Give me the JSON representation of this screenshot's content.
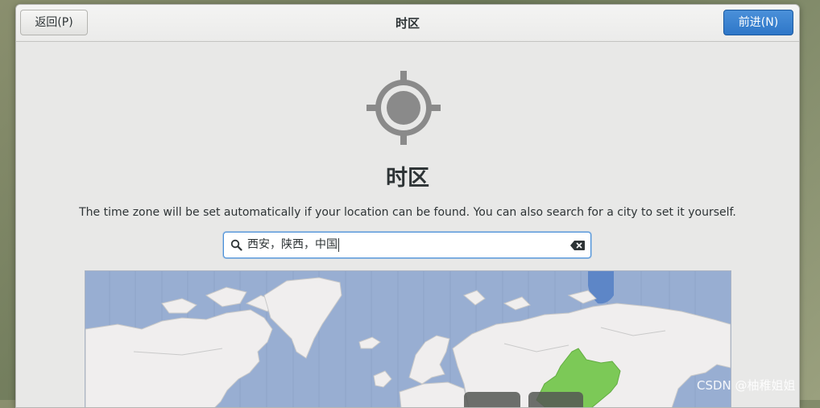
{
  "headerbar": {
    "back_label": "返回(P)",
    "title": "时区",
    "next_label": "前进(N)"
  },
  "page": {
    "title": "时区",
    "description": "The time zone will be set automatically if your location can be found. You can also search for a city to set it yourself."
  },
  "search": {
    "value": "西安，陕西，中国"
  },
  "icons": {
    "location": "location-crosshair-icon",
    "search": "search-icon",
    "clear": "clear-text-icon"
  },
  "colors": {
    "accent": "#4a90d9",
    "map_ocean": "#98aed2",
    "map_land": "#f0eeee",
    "selected_timezone": "#7cc957"
  },
  "watermark": "CSDN @柚稚姐姐"
}
